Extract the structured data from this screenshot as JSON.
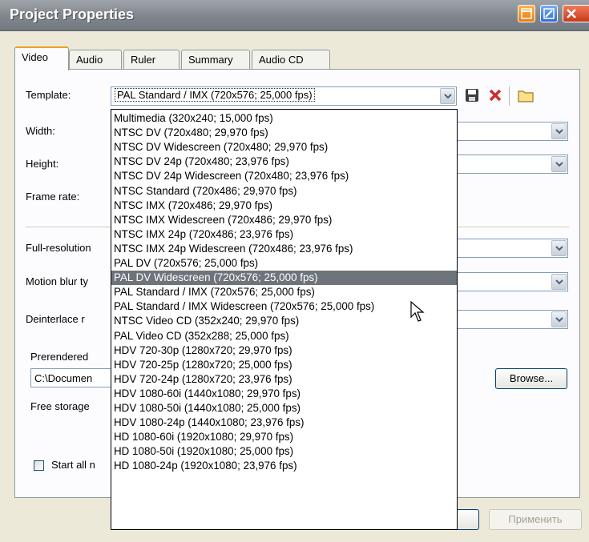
{
  "window": {
    "title": "Project Properties"
  },
  "tabs": [
    {
      "label": "Video"
    },
    {
      "label": "Audio"
    },
    {
      "label": "Ruler"
    },
    {
      "label": "Summary"
    },
    {
      "label": "Audio CD"
    }
  ],
  "fields": {
    "template_label": "Template:",
    "template_value": "PAL Standard / IMX (720x576; 25,000 fps)",
    "width_label": "Width:",
    "height_label": "Height:",
    "framerate_label": "Frame rate:",
    "fullres_label": "Full-resolution",
    "motionblur_label": "Motion blur ty",
    "deinterlace_label": "Deinterlace r",
    "prerendered_label": "Prerendered",
    "path_value": "C:\\Documen",
    "free_storage_label": "Free storage",
    "start_all_label": "Start all n"
  },
  "buttons": {
    "browse": "Browse...",
    "apply": "Применить"
  },
  "dropdown": {
    "highlighted_index": 13,
    "options": [
      "Multimedia (320x240; 15,000 fps)",
      "NTSC DV (720x480; 29,970 fps)",
      "NTSC DV Widescreen (720x480; 29,970 fps)",
      "NTSC DV 24p (720x480; 23,976 fps)",
      "NTSC DV 24p Widescreen (720x480; 23,976 fps)",
      "NTSC Standard (720x486; 29,970 fps)",
      "NTSC IMX (720x486; 29,970 fps)",
      "NTSC IMX Widescreen (720x486; 29,970 fps)",
      "NTSC IMX 24p (720x486; 23,976 fps)",
      "NTSC IMX 24p Widescreen (720x486; 23,976 fps)",
      "PAL DV (720x576; 25,000 fps)",
      "PAL DV Widescreen (720x576; 25,000 fps)",
      "PAL Standard / IMX (720x576; 25,000 fps)",
      "PAL Standard / IMX Widescreen (720x576; 25,000 fps)",
      "NTSC Video CD (352x240; 29,970 fps)",
      "PAL Video CD (352x288; 25,000 fps)",
      "HDV 720-30p (1280x720; 29,970 fps)",
      "HDV 720-25p (1280x720; 25,000 fps)",
      "HDV 720-24p (1280x720; 23,976 fps)",
      "HDV 1080-60i (1440x1080; 29,970 fps)",
      "HDV 1080-50i (1440x1080; 25,000 fps)",
      "HDV 1080-24p (1440x1080; 23,976 fps)",
      "HD 1080-60i (1920x1080; 29,970 fps)",
      "HD 1080-50i (1920x1080; 25,000 fps)",
      "HD 1080-24p (1920x1080; 23,976 fps)"
    ]
  },
  "icons": [
    "help-icon",
    "maximize-icon",
    "close-icon",
    "save-icon",
    "delete-icon",
    "folder-icon",
    "dropdown-arrow-icon",
    "mouse-cursor-icon"
  ]
}
